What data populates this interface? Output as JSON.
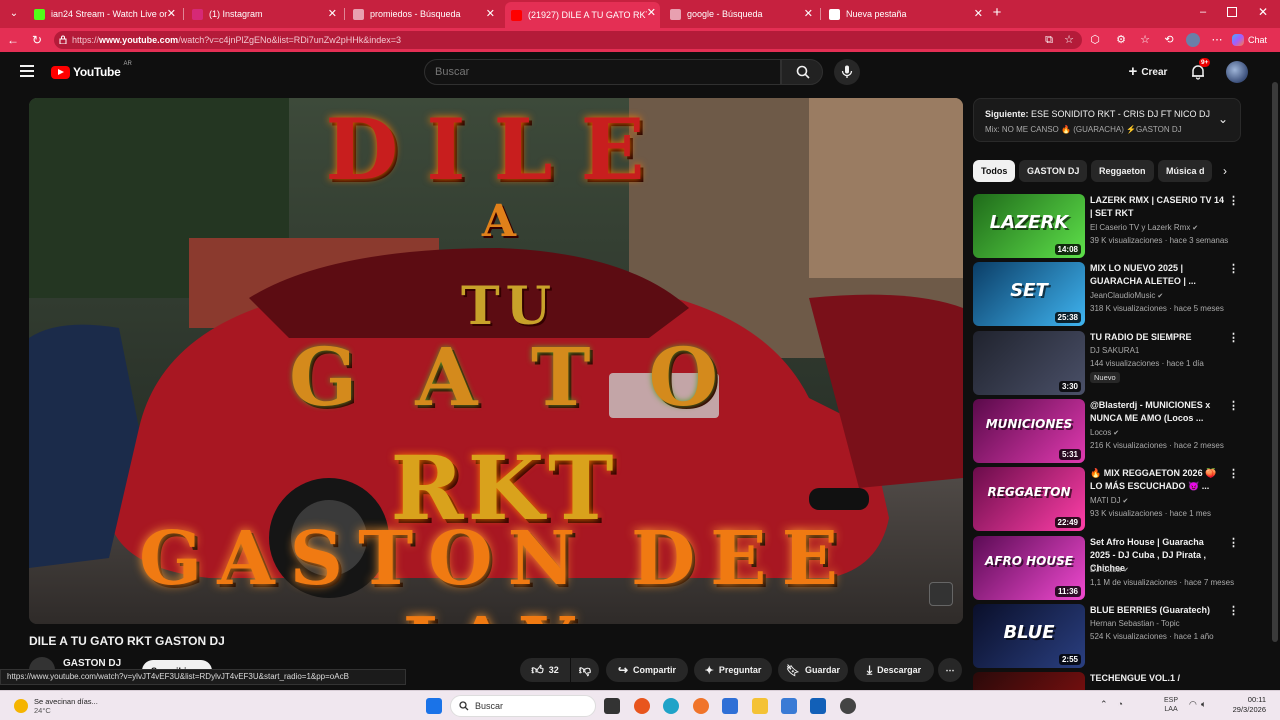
{
  "browser": {
    "tabs": [
      {
        "title": "ian24 Stream - Watch Live on Kick",
        "icon": "kick-icon",
        "color": "#53fc18"
      },
      {
        "title": "(1) Instagram",
        "icon": "instagram-icon",
        "color": "#d62976"
      },
      {
        "title": "promiedos - Búsqueda",
        "icon": "search-icon",
        "color": "#e8a0b0"
      },
      {
        "title": "(21927) DILE A TU GATO RKT",
        "icon": "youtube-icon",
        "color": "#ff0000"
      },
      {
        "title": "google - Búsqueda",
        "icon": "search-icon",
        "color": "#e8a0b0"
      },
      {
        "title": "Nueva pestaña",
        "icon": "newtab-icon",
        "color": "#ffffff"
      }
    ],
    "url_prefix": "https://",
    "url_host": "www.youtube.com",
    "url_path": "/watch?v=c4jnPlZgENo&list=RDi7unZw2pHHk&index=3",
    "chat_label": "Chat"
  },
  "youtube": {
    "logo": "YouTube",
    "region": "AR",
    "search_placeholder": "Buscar",
    "create_label": "Crear",
    "notif_count": "9+"
  },
  "video": {
    "title_overlay": {
      "line1": "DILE",
      "line2": "A",
      "line3": "TU",
      "line4": "GATO",
      "line5": "RKT",
      "line6": "GASTON DEE JAY"
    },
    "title": "DILE A TU GATO RKT GASTON DJ",
    "channel": "GASTON DJ",
    "subscribe": "Suscribirme",
    "likes": "32",
    "share": "Compartir",
    "ask": "Preguntar",
    "save": "Guardar",
    "download": "Descargar"
  },
  "status_url": "https://www.youtube.com/watch?v=ylvJT4vEF3U&list=RDylvJT4vEF3U&start_radio=1&pp=oAcB",
  "upnext": {
    "label": "Siguiente:",
    "title": "ESE SONIDITO RKT - CRIS DJ FT NICO DJ",
    "mix": "Mix: NO ME CANSO 🔥 (GUARACHA) ⚡GASTON DJ"
  },
  "chips": [
    "Todos",
    "GASTON DJ",
    "Reggaeton",
    "Música d"
  ],
  "recommendations": [
    {
      "title": "LAZERK RMX | CASERIO TV 14 | SET RKT",
      "channel": "El Caserio TV y Lazerk Rmx",
      "verified": true,
      "meta": "39 K visualizaciones · hace 3 semanas",
      "duration": "14:08",
      "thumb_text": "LAZERK",
      "c1": "#1f6b1a",
      "c2": "#5ee04a"
    },
    {
      "title": "MIX LO NUEVO 2025 | GUARACHA ALETEO | ...",
      "channel": "JeanClaudioMusic",
      "verified": true,
      "meta": "318 K visualizaciones · hace 5 meses",
      "duration": "25:38",
      "thumb_text": "SET",
      "c1": "#0b3d66",
      "c2": "#3fb4f0"
    },
    {
      "title": "TU RADIO DE SIEMPRE",
      "channel": "DJ SAKURA1",
      "verified": false,
      "meta": "144 visualizaciones · hace 1 día",
      "duration": "3:30",
      "badge": "Nuevo",
      "thumb_text": "",
      "c1": "#20232e",
      "c2": "#4a5068"
    },
    {
      "title": "@Blasterdj - MUNICIONES x NUNCA ME AMO (Locos ...",
      "channel": "Locos",
      "verified": true,
      "meta": "216 K visualizaciones · hace 2 meses",
      "duration": "5:31",
      "thumb_text": "MUNICIONES",
      "c1": "#5a0a4a",
      "c2": "#e03ab0"
    },
    {
      "title": "🔥 MIX REGGAETON 2026 🍑 LO MÁS ESCUCHADO 😈 ...",
      "channel": "MATI DJ",
      "verified": true,
      "meta": "93 K visualizaciones · hace 1 mes",
      "duration": "22:49",
      "thumb_text": "REGGAETON",
      "c1": "#6a0c4a",
      "c2": "#ff3fa8"
    },
    {
      "title": "Set Afro House | Guaracha 2025 - DJ Cuba , DJ Pirata , Chichee",
      "channel": "DJ Cuba",
      "verified": true,
      "meta": "1,1 M de visualizaciones · hace 7 meses",
      "duration": "11:36",
      "thumb_text": "AFRO HOUSE",
      "c1": "#5b0b54",
      "c2": "#f04ad0"
    },
    {
      "title": "BLUE BERRIES (Guaratech)",
      "channel": "Hernan Sebastian - Topic",
      "verified": false,
      "meta": "524 K visualizaciones · hace 1 año",
      "duration": "2:55",
      "thumb_text": "BLUE",
      "c1": "#0a0f2a",
      "c2": "#2a3f80"
    },
    {
      "title": "TECHENGUE VOL.1 /",
      "channel": "",
      "verified": false,
      "meta": "",
      "duration": "",
      "thumb_text": "",
      "c1": "#2a0a0a",
      "c2": "#8a1010"
    }
  ],
  "taskbar": {
    "weather_text": "Se avecinan días...",
    "weather_temp": "24°C",
    "search": "Buscar",
    "lang1": "ESP",
    "lang2": "LAA",
    "time": "00:11",
    "date": "29/3/2026"
  }
}
